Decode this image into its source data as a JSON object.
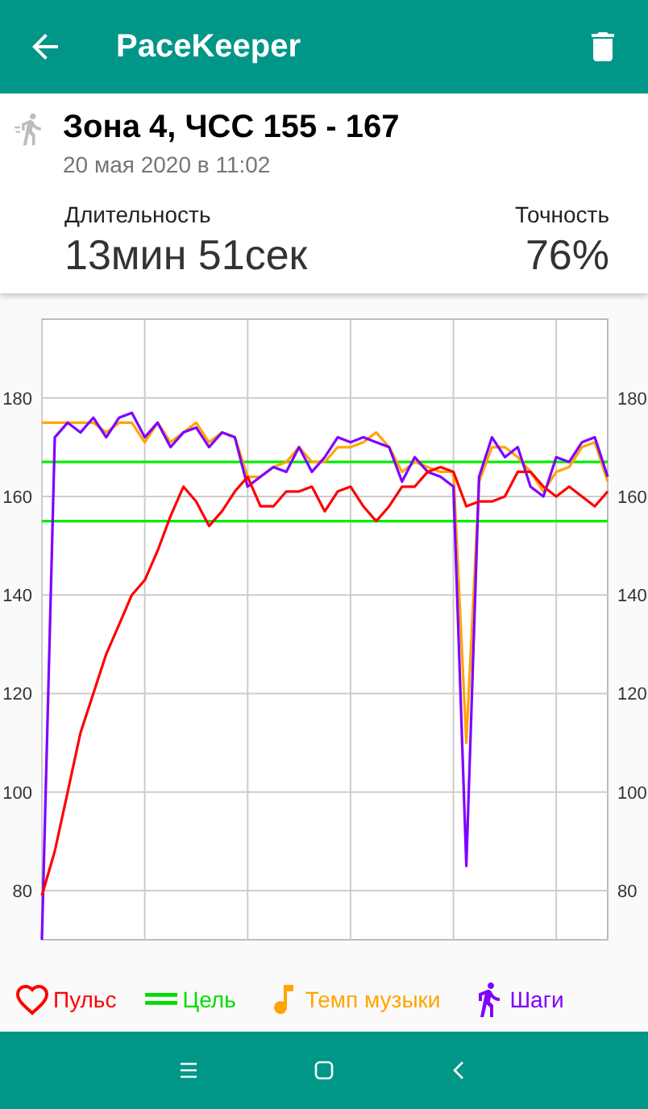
{
  "app_bar": {
    "title": "PaceKeeper"
  },
  "workout": {
    "title": "Зона 4, ЧСС 155 - 167",
    "date": "20 мая 2020 в 11:02"
  },
  "stats": [
    {
      "label": "Длительность",
      "value": "13мин 51сек"
    },
    {
      "label": "Точность",
      "value": "76%"
    }
  ],
  "chart": {
    "chart_data": {
      "type": "line",
      "ylim": [
        70,
        196
      ],
      "yticks": [
        80,
        100,
        120,
        140,
        160,
        180
      ],
      "grid": true,
      "series": [
        {
          "color": "#ffa500",
          "values": [
            175,
            175,
            175,
            175,
            175,
            173,
            175,
            175,
            171,
            175,
            171,
            173,
            175,
            171,
            173,
            172,
            164,
            164,
            166,
            167,
            170,
            167,
            167,
            170,
            170,
            171,
            173,
            170,
            165,
            167,
            166,
            165,
            165,
            110,
            163,
            170,
            170,
            168,
            165,
            161,
            165,
            166,
            170,
            171,
            163
          ]
        },
        {
          "color": "#7f00ff",
          "values": [
            70,
            172,
            175,
            173,
            176,
            172,
            176,
            177,
            172,
            175,
            170,
            173,
            174,
            170,
            173,
            172,
            162,
            164,
            166,
            165,
            170,
            165,
            168,
            172,
            171,
            172,
            171,
            170,
            163,
            168,
            165,
            164,
            162,
            85,
            164,
            172,
            168,
            170,
            162,
            160,
            168,
            167,
            171,
            172,
            164
          ]
        },
        {
          "color": "#ff0000",
          "values": [
            79,
            88,
            100,
            112,
            120,
            128,
            134,
            140,
            143,
            149,
            156,
            162,
            159,
            154,
            157,
            161,
            164,
            158,
            158,
            161,
            161,
            162,
            157,
            161,
            162,
            158,
            155,
            158,
            162,
            162,
            165,
            166,
            165,
            158,
            159,
            159,
            160,
            165,
            165,
            162,
            160,
            162,
            160,
            158,
            161
          ]
        }
      ],
      "ref_lines": [
        {
          "axis": "y",
          "value": 167,
          "color": "#00ee00"
        },
        {
          "axis": "y",
          "value": 155,
          "color": "#00ee00"
        }
      ]
    },
    "right_ticks": [
      "180",
      "160",
      "140",
      "120",
      "100",
      "80"
    ]
  },
  "legend": [
    {
      "kind": "heart",
      "label": "Пульс",
      "color": "#ff0000"
    },
    {
      "kind": "target",
      "label": "Цель",
      "color": "#00dd00"
    },
    {
      "kind": "note",
      "label": "Темп музыки",
      "color": "#ffa500"
    },
    {
      "kind": "runner",
      "label": "Шаги",
      "color": "#7f00ff"
    }
  ]
}
